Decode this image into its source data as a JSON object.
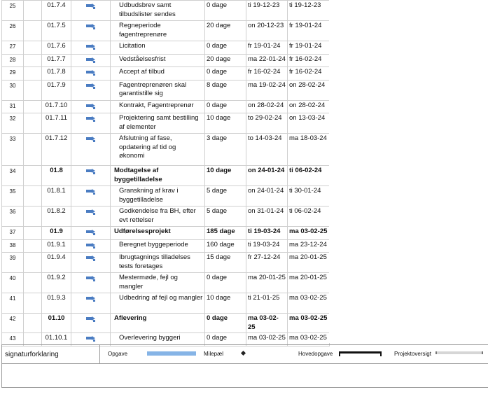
{
  "rows": [
    {
      "id": "25",
      "wbs": "01.7.4",
      "name": "Udbudsbrev samt tilbudslister sendes",
      "duration": "0 dage",
      "start": "ti 19-12-23",
      "finish": "ti 19-12-23",
      "summary": false
    },
    {
      "id": "26",
      "wbs": "01.7.5",
      "name": "Regneperiode fagentreprenøre",
      "duration": "20 dage",
      "start": "on 20-12-23",
      "finish": "fr 19-01-24",
      "summary": false
    },
    {
      "id": "27",
      "wbs": "01.7.6",
      "name": "Licitation",
      "duration": "0 dage",
      "start": "fr 19-01-24",
      "finish": "fr 19-01-24",
      "summary": false
    },
    {
      "id": "28",
      "wbs": "01.7.7",
      "name": "Vedståelsesfrist",
      "duration": "20 dage",
      "start": "ma 22-01-24",
      "finish": "fr 16-02-24",
      "summary": false
    },
    {
      "id": "29",
      "wbs": "01.7.8",
      "name": "Accept af tilbud",
      "duration": "0 dage",
      "start": "fr 16-02-24",
      "finish": "fr 16-02-24",
      "summary": false
    },
    {
      "id": "30",
      "wbs": "01.7.9",
      "name": "Fagentreprenøren skal garantistille sig",
      "duration": "8 dage",
      "start": "ma 19-02-24",
      "finish": "on 28-02-24",
      "summary": false
    },
    {
      "id": "31",
      "wbs": "01.7.10",
      "name": "Kontrakt, Fagentreprenør",
      "duration": "0 dage",
      "start": "on 28-02-24",
      "finish": "on 28-02-24",
      "summary": false
    },
    {
      "id": "32",
      "wbs": "01.7.11",
      "name": "Projektering samt bestilling af elementer",
      "duration": "10 dage",
      "start": "to 29-02-24",
      "finish": "on 13-03-24",
      "summary": false
    },
    {
      "id": "33",
      "wbs": "01.7.12",
      "name": "Afslutning af fase, opdatering af tid og økonomi",
      "duration": "3 dage",
      "start": "to 14-03-24",
      "finish": "ma 18-03-24",
      "summary": false
    },
    {
      "id": "34",
      "wbs": "01.8",
      "name": "Modtagelse af byggetilladelse",
      "duration": "10 dage",
      "start": "on 24-01-24",
      "finish": "ti 06-02-24",
      "summary": true
    },
    {
      "id": "35",
      "wbs": "01.8.1",
      "name": "Granskning af krav i byggetilladelse",
      "duration": "5 dage",
      "start": "on 24-01-24",
      "finish": "ti 30-01-24",
      "summary": false
    },
    {
      "id": "36",
      "wbs": "01.8.2",
      "name": "Godkendelse fra BH, efter evt rettelser",
      "duration": "5 dage",
      "start": "on 31-01-24",
      "finish": "ti 06-02-24",
      "summary": false
    },
    {
      "id": "37",
      "wbs": "01.9",
      "name": "Udførelsesprojekt",
      "duration": "185 dage",
      "start": "ti 19-03-24",
      "finish": "ma 03-02-25",
      "summary": true
    },
    {
      "id": "38",
      "wbs": "01.9.1",
      "name": "Beregnet byggeperiode",
      "duration": "160 dage",
      "start": "ti 19-03-24",
      "finish": "ma 23-12-24",
      "summary": false
    },
    {
      "id": "39",
      "wbs": "01.9.4",
      "name": "Ibrugtagnings tilladelses tests foretages",
      "duration": "15 dage",
      "start": "fr 27-12-24",
      "finish": "ma 20-01-25",
      "summary": false
    },
    {
      "id": "40",
      "wbs": "01.9.2",
      "name": "Mestermøde, fejl og mangler",
      "duration": "0 dage",
      "start": "ma 20-01-25",
      "finish": "ma 20-01-25",
      "summary": false
    },
    {
      "id": "41",
      "wbs": "01.9.3",
      "name": "Udbedring af fejl og mangler",
      "duration": "10 dage",
      "start": "ti 21-01-25",
      "finish": "ma 03-02-25",
      "summary": false
    },
    {
      "id": "42",
      "wbs": "01.10",
      "name": "Aflevering",
      "duration": "0 dage",
      "start": "ma 03-02-25",
      "finish": "ma 03-02-25",
      "summary": true
    },
    {
      "id": "43",
      "wbs": "01.10.1",
      "name": "Overlevering byggeri",
      "duration": "0 dage",
      "start": "ma 03-02-25",
      "finish": "ma 03-02-25",
      "summary": false
    }
  ],
  "legend": {
    "title": "signaturforklaring",
    "task_label": "Opgave",
    "milestone_label": "Milepæl",
    "summary_label": "Hovedopgave",
    "project_summary_label": "Projektoversigt"
  },
  "colors": {
    "task_mode_icon": "#4a7cc2",
    "task_bar": "#86b4e6"
  }
}
